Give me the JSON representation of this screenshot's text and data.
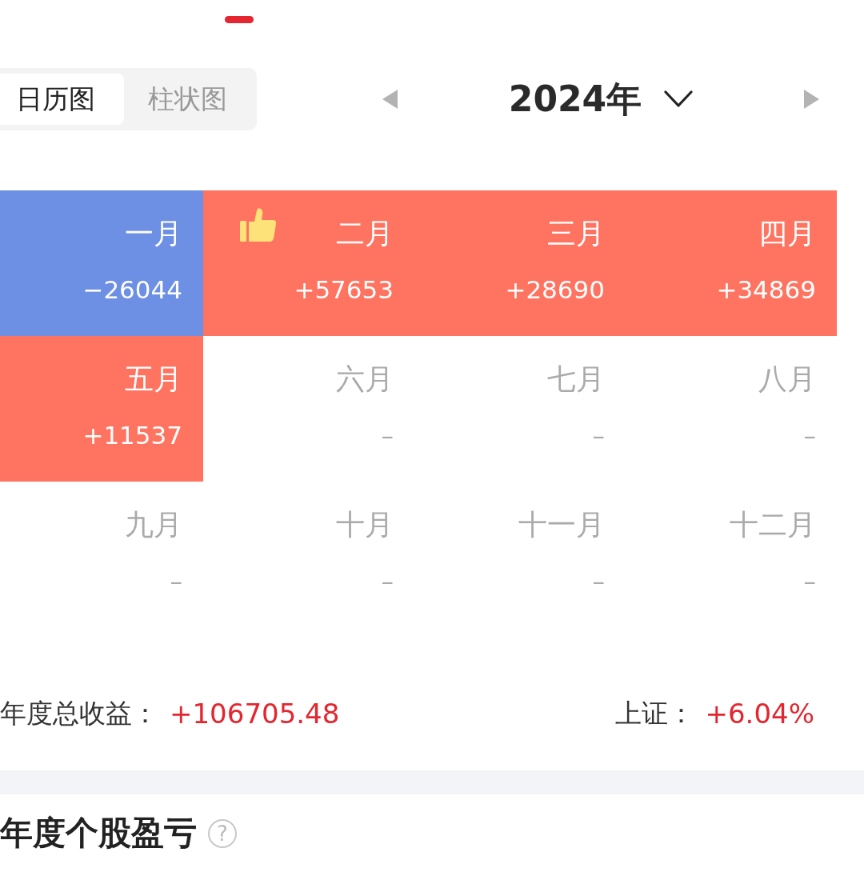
{
  "view_toggle": [
    {
      "label": "日历图",
      "selected": true
    },
    {
      "label": "柱状图",
      "selected": false
    }
  ],
  "year_picker": {
    "year": "2024年"
  },
  "months": [
    {
      "name": "一月",
      "value": "−26044",
      "kind": "filled",
      "color": "#6d8fe4",
      "best": false
    },
    {
      "name": "二月",
      "value": "+57653",
      "kind": "filled",
      "color": "#fe7461",
      "best": true
    },
    {
      "name": "三月",
      "value": "+28690",
      "kind": "filled",
      "color": "#fe7461",
      "best": false
    },
    {
      "name": "四月",
      "value": "+34869",
      "kind": "filled",
      "color": "#fe7461",
      "best": false
    },
    {
      "name": "五月",
      "value": "+11537",
      "kind": "filled",
      "color": "#fe7461",
      "best": false
    },
    {
      "name": "六月",
      "value": "–",
      "kind": "empty",
      "best": false
    },
    {
      "name": "七月",
      "value": "–",
      "kind": "empty",
      "best": false
    },
    {
      "name": "八月",
      "value": "–",
      "kind": "empty",
      "best": false
    },
    {
      "name": "九月",
      "value": "–",
      "kind": "empty",
      "best": false
    },
    {
      "name": "十月",
      "value": "–",
      "kind": "empty",
      "best": false
    },
    {
      "name": "十一月",
      "value": "–",
      "kind": "empty",
      "best": false
    },
    {
      "name": "十二月",
      "value": "–",
      "kind": "empty",
      "best": false
    }
  ],
  "summary": {
    "label": "年度总收益：",
    "value": "+106705.48",
    "index_label": "上证：",
    "index_value": "+6.04%"
  },
  "section": {
    "title": "年度个股盈亏",
    "help": "?"
  }
}
